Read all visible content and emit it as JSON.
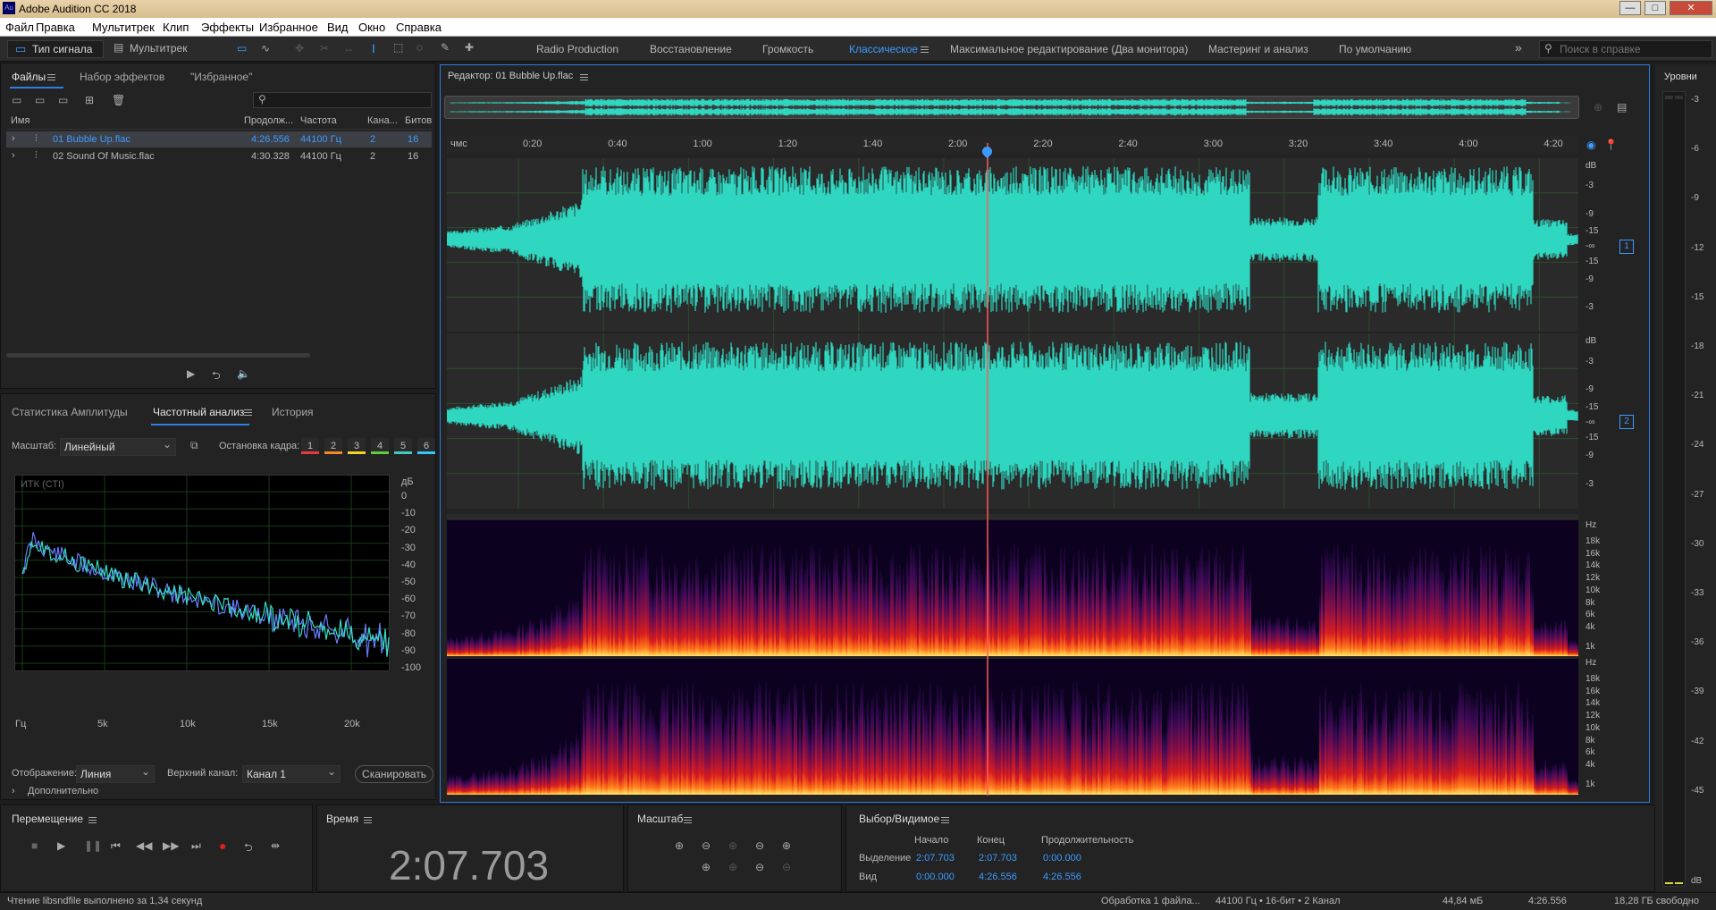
{
  "window": {
    "title": "Adobe Audition CC 2018",
    "logo": "Au",
    "buttons": [
      "—",
      "□",
      "✕"
    ]
  },
  "menu": [
    "Файл",
    "Правка",
    "Мультитрек",
    "Клип",
    "Эффекты",
    "Избранное",
    "Вид",
    "Окно",
    "Справка"
  ],
  "toolbar": {
    "waveform_mode": "Тип сигнала",
    "multitrack_mode": "Мультитрек",
    "search_placeholder": "Поиск в справке",
    "workspaces": [
      "Radio Production",
      "Восстановление",
      "Громкость",
      "Классическое",
      "Максимальное редактирование (Два монитора)",
      "Мастеринг и анализ",
      "По умолчанию"
    ],
    "active_workspace": "Классическое",
    "more": "»"
  },
  "files_panel": {
    "tabs": [
      "Файлы",
      "Набор эффектов",
      "\"Избранное\""
    ],
    "search_placeholder": "",
    "columns": [
      "Имя",
      "Продолж...",
      "Частота",
      "Кана...",
      "Битов"
    ],
    "rows": [
      {
        "name": "01 Bubble Up.flac",
        "duration": "4:26.556",
        "rate": "44100 Гц",
        "channels": "2",
        "bits": "16",
        "selected": true
      },
      {
        "name": "02 Sound Of Music.flac",
        "duration": "4:30.328",
        "rate": "44100 Гц",
        "channels": "2",
        "bits": "16",
        "selected": false
      }
    ]
  },
  "analysis_panel": {
    "tabs": [
      "Статистика Амплитуды",
      "Частотный анализ",
      "История"
    ],
    "scale_label": "Масштаб:",
    "scale_value": "Линейный",
    "freeze_label": "Остановка кадра:",
    "frames": [
      "1",
      "2",
      "3",
      "4",
      "5",
      "6"
    ],
    "frame_colors": [
      "#e53b3b",
      "#f08a24",
      "#f3d323",
      "#5dcf3f",
      "#3ecbbd",
      "#32c6f4"
    ],
    "plot_label": "ИТК (СТI)",
    "db_ticks": [
      "дБ",
      "0",
      "-10",
      "-20",
      "-30",
      "-40",
      "-50",
      "-60",
      "-70",
      "-80",
      "-90",
      "-100"
    ],
    "freq_ticks": [
      "Гц",
      "5k",
      "10k",
      "15k",
      "20k"
    ],
    "display_label": "Отображение:",
    "display_value": "Линия",
    "channel_label": "Верхний канал:",
    "channel_value": "Канал 1",
    "scan_button": "Сканировать",
    "advanced": "Дополнительно"
  },
  "editor": {
    "title": "Редактор: 01 Bubble Up.flac",
    "time_ticks": [
      "чмс",
      "0:20",
      "0:40",
      "1:00",
      "1:20",
      "1:40",
      "2:00",
      "2:20",
      "2:40",
      "3:00",
      "3:20",
      "3:40",
      "4:00",
      "4:20"
    ],
    "db_ticks_ch": [
      "dB",
      "-3",
      "-9",
      "-15",
      "-∞",
      "-15",
      "-9",
      "-3"
    ],
    "channels": [
      "1",
      "2"
    ],
    "hz_ticks": [
      "Hz",
      "18k",
      "16k",
      "14k",
      "12k",
      "10k",
      "8k",
      "6k",
      "4k",
      "1k"
    ],
    "playhead": "2:07.703",
    "waveform_color": "#2fd6c0"
  },
  "levels": {
    "title": "Уровни",
    "ticks": [
      "-3",
      "-6",
      "-9",
      "-12",
      "-15",
      "-18",
      "-21",
      "-24",
      "-27",
      "-30",
      "-33",
      "-36",
      "-39",
      "-42",
      "-45",
      "dB"
    ]
  },
  "transport": {
    "title": "Перемещение",
    "buttons": [
      "stop",
      "play",
      "pause",
      "to-start",
      "rewind",
      "fast-forward",
      "to-end",
      "record",
      "loop",
      "skip"
    ]
  },
  "time": {
    "title": "Время",
    "value": "2:07.703"
  },
  "zoom": {
    "title": "Масштаб"
  },
  "selection": {
    "title": "Выбор/Видимое",
    "col_start": "Начало",
    "col_end": "Конец",
    "col_duration": "Продолжительность",
    "rows": [
      {
        "label": "Выделение",
        "start": "2:07.703",
        "end": "2:07.703",
        "duration": "0:00.000"
      },
      {
        "label": "Вид",
        "start": "0:00.000",
        "end": "4:26.556",
        "duration": "4:26.556"
      }
    ]
  },
  "status": {
    "left": "Чтение libsndfile выполнено за 1,34 секунд",
    "processing": "Обработка 1 файла...",
    "format": "44100 Гц • 16-бит • 2 Канал",
    "size": "44,84 мБ",
    "duration": "4:26.556",
    "free": "18,28 ГБ свободно"
  }
}
